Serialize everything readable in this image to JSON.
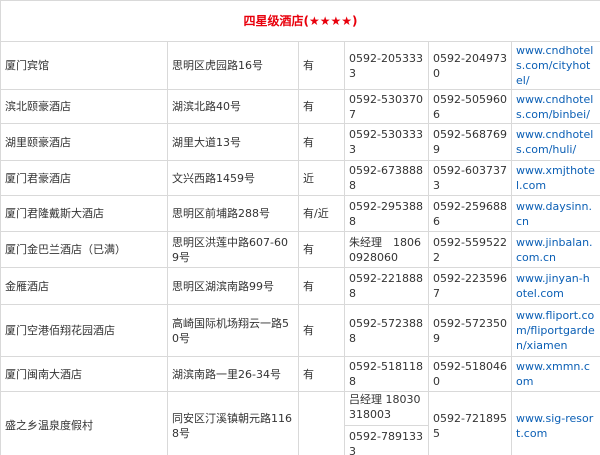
{
  "title": "四星级酒店(★★★★)",
  "rows": [
    {
      "name": "厦门宾馆",
      "address": "思明区虎园路16号",
      "note": "有",
      "tel": "0592-2053333",
      "fax": "0592-2049730",
      "site": "www.cndhotels.com/cityhotel/"
    },
    {
      "name": "滨北颐豪酒店",
      "address": "湖滨北路40号",
      "note": "有",
      "tel": "0592-5303707",
      "fax": "0592-5059606",
      "site": "www.cndhotels.com/binbei/"
    },
    {
      "name": "湖里颐豪酒店",
      "address": "湖里大道13号",
      "note": "有",
      "tel": "0592-5303333",
      "fax": "0592-5687699",
      "site": "www.cndhotels.com/huli/"
    },
    {
      "name": "厦门君豪酒店",
      "address": "文兴西路1459号",
      "note": "近",
      "tel": "0592-6738888",
      "fax": "0592-6037373",
      "site": "www.xmjthotel.com"
    },
    {
      "name": "厦门君隆戴斯大酒店",
      "address": "思明区前埔路288号",
      "note": "有/近",
      "tel": "0592-2953888",
      "fax": "0592-2596886",
      "site": "www.daysinn.cn"
    },
    {
      "name": "厦门金巴兰酒店（已满）",
      "address": "思明区洪莲中路607-609号",
      "note": "有",
      "tel": "朱经理　18060928060",
      "fax": "0592-5595222",
      "site": "www.jinbalan.com.cn"
    },
    {
      "name": "金雁酒店",
      "address": "思明区湖滨南路99号",
      "note": "有",
      "tel": "0592-2218888",
      "fax": "0592-2235967",
      "site": "www.jinyan-hotel.com"
    },
    {
      "name": "厦门空港佰翔花园酒店",
      "address": "高崎国际机场翔云一路50号",
      "note": "有",
      "tel": "0592-5723888",
      "fax": "0592-5723509",
      "site": "www.fliport.com/fliportgarden/xiamen"
    },
    {
      "name": "厦门闽南大酒店",
      "address": "湖滨南路一里26-34号",
      "note": "有",
      "tel": "0592-5181188",
      "fax": "0592-5180460",
      "site": "www.xmmn.com"
    },
    {
      "name": "盛之乡温泉度假村",
      "address": "同安区汀溪镇朝元路1168号",
      "note": "",
      "tel": "吕经理 18030318003",
      "tel2": "0592-7891333",
      "fax": "0592-7218955",
      "site": "www.sig-resort.com"
    }
  ]
}
